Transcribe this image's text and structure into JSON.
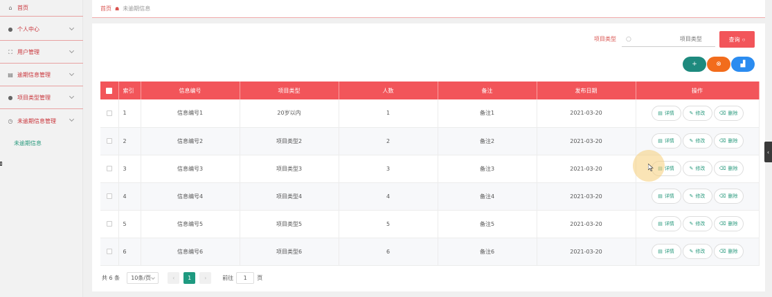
{
  "sidebar": {
    "items": [
      {
        "label": "首页",
        "icon": "home-icon"
      },
      {
        "label": "个人中心",
        "icon": "user-icon"
      },
      {
        "label": "用户管理",
        "icon": "frame-icon"
      },
      {
        "label": "逾期信息管理",
        "icon": "bank-icon"
      },
      {
        "label": "项目类型管理",
        "icon": "user-icon"
      },
      {
        "label": "未逾期信息管理",
        "icon": "clock-icon"
      }
    ],
    "active_sub": "未逾期信息"
  },
  "breadcrumb": {
    "home": "首页",
    "current": "未逾期信息"
  },
  "search": {
    "label": "项目类型",
    "placeholder": "项目类型",
    "button": "查询"
  },
  "actions": {
    "add": "+",
    "delete": "⊗",
    "chart": "▟"
  },
  "table": {
    "headers": [
      "索引",
      "信息编号",
      "项目类型",
      "人数",
      "备注",
      "发布日期",
      "操作"
    ],
    "rows": [
      {
        "idx": "1",
        "code": "信息编号1",
        "type": "20岁以内",
        "count": "1",
        "note": "备注1",
        "date": "2021-03-20"
      },
      {
        "idx": "2",
        "code": "信息编号2",
        "type": "项目类型2",
        "count": "2",
        "note": "备注2",
        "date": "2021-03-20"
      },
      {
        "idx": "3",
        "code": "信息编号3",
        "type": "项目类型3",
        "count": "3",
        "note": "备注3",
        "date": "2021-03-20"
      },
      {
        "idx": "4",
        "code": "信息编号4",
        "type": "项目类型4",
        "count": "4",
        "note": "备注4",
        "date": "2021-03-20"
      },
      {
        "idx": "5",
        "code": "信息编号5",
        "type": "项目类型5",
        "count": "5",
        "note": "备注5",
        "date": "2021-03-20"
      },
      {
        "idx": "6",
        "code": "信息编号6",
        "type": "项目类型6",
        "count": "6",
        "note": "备注6",
        "date": "2021-03-20"
      }
    ],
    "ops": {
      "detail": "详情",
      "edit": "修改",
      "delete": "删除"
    }
  },
  "pagination": {
    "total": "共 6 条",
    "page_size": "10条/页",
    "current": "1",
    "goto_label": "前往",
    "goto_value": "1",
    "page_suffix": "页"
  },
  "colors": {
    "primary": "#f2555a",
    "accent": "#1e9a80",
    "orange": "#f26c1c",
    "blue": "#2b8cf0"
  }
}
